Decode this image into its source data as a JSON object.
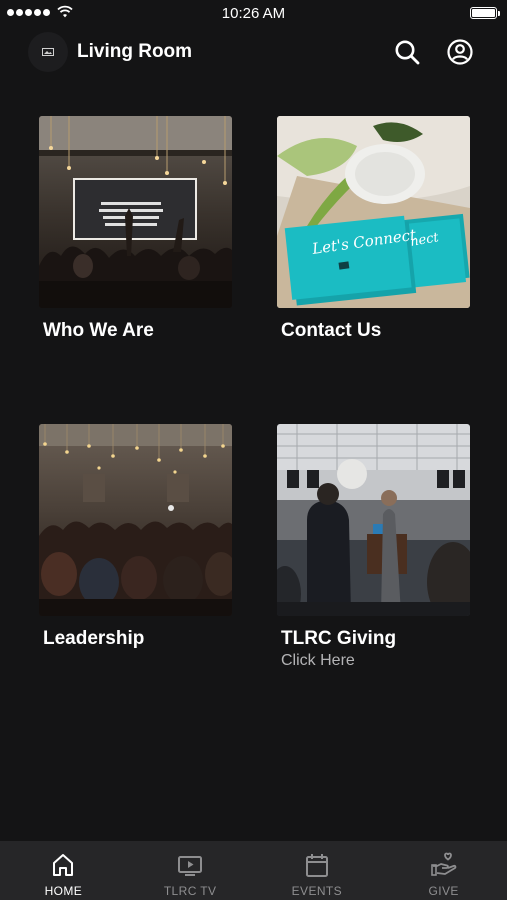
{
  "status_bar": {
    "time": "10:26 AM"
  },
  "header": {
    "title": "Living Room"
  },
  "tiles": [
    {
      "title": "Who We Are",
      "subtitle": ""
    },
    {
      "title": "Contact Us",
      "subtitle": ""
    },
    {
      "title": "Leadership",
      "subtitle": ""
    },
    {
      "title": "TLRC Giving",
      "subtitle": "Click Here"
    }
  ],
  "contact_card": {
    "line1": "Let's Connect",
    "line2": "nect"
  },
  "tabs": [
    {
      "label": "HOME",
      "icon": "home-icon",
      "active": true
    },
    {
      "label": "TLRC TV",
      "icon": "tv-icon",
      "active": false
    },
    {
      "label": "EVENTS",
      "icon": "calendar-icon",
      "active": false
    },
    {
      "label": "GIVE",
      "icon": "give-hand-icon",
      "active": false
    }
  ],
  "colors": {
    "background": "#141415",
    "tabbar": "#262628",
    "active_tab": "#ffffff",
    "inactive_tab": "#8e8e90",
    "contact_card": "#1bbcc3"
  }
}
